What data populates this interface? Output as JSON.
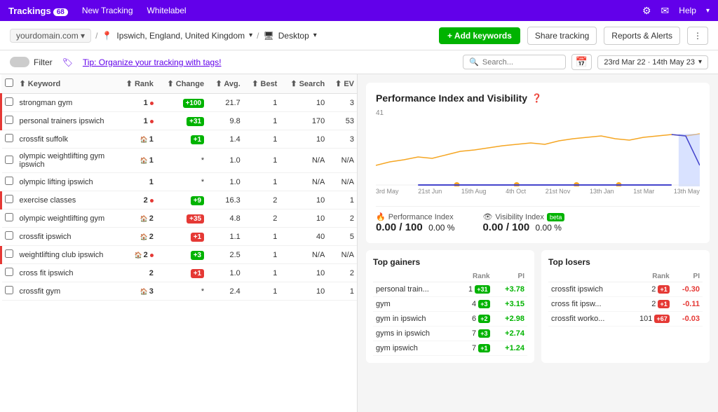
{
  "topNav": {
    "brand": "Trackings",
    "badge": "68",
    "links": [
      "New Tracking",
      "Whitelabel"
    ],
    "helpLabel": "Help"
  },
  "secondaryToolbar": {
    "domainPlaceholder": "yourdomain.com",
    "location": "Ipswich, England, United Kingdom",
    "device": "Desktop",
    "addKeywordsLabel": "+ Add keywords",
    "shareTrackingLabel": "Share tracking",
    "reportsAlertsLabel": "Reports & Alerts"
  },
  "filterBar": {
    "filterLabel": "Filter",
    "tipText": "Tip: Organize your tracking with tags!",
    "searchPlaceholder": "Search...",
    "dateRange": "23rd Mar 22  ·  14th May 23"
  },
  "table": {
    "headers": [
      "",
      "Keyword",
      "Rank",
      "Change",
      "Avg.",
      "Best",
      "Search",
      "EV"
    ],
    "rows": [
      {
        "keyword": "strongman gym",
        "rank": "1",
        "rankDot": "red",
        "change": "+100",
        "changeType": "green",
        "avg": "21.7",
        "best": "1",
        "search": "10",
        "ev": "3"
      },
      {
        "keyword": "personal trainers ipswich",
        "rank": "1",
        "rankDot": "red",
        "change": "+31",
        "changeType": "green",
        "avg": "9.8",
        "best": "1",
        "search": "170",
        "ev": "53"
      },
      {
        "keyword": "crossfit suffolk",
        "rank": "1",
        "rankDot": "",
        "change": "+1",
        "changeType": "green",
        "avg": "1.4",
        "best": "1",
        "search": "10",
        "ev": "3",
        "local": true
      },
      {
        "keyword": "olympic weightlifting gym ipswich",
        "rank": "1",
        "rankDot": "",
        "change": "*",
        "changeType": "none",
        "avg": "1.0",
        "best": "1",
        "search": "N/A",
        "ev": "N/A",
        "local": true
      },
      {
        "keyword": "olympic lifting ipswich",
        "rank": "1",
        "rankDot": "",
        "change": "*",
        "changeType": "none",
        "avg": "1.0",
        "best": "1",
        "search": "N/A",
        "ev": "N/A"
      },
      {
        "keyword": "exercise classes",
        "rank": "2",
        "rankDot": "red",
        "change": "+9",
        "changeType": "green",
        "avg": "16.3",
        "best": "2",
        "search": "10",
        "ev": "1"
      },
      {
        "keyword": "olympic weightlifting gym",
        "rank": "2",
        "rankDot": "",
        "change": "+35",
        "changeType": "red",
        "avg": "4.8",
        "best": "2",
        "search": "10",
        "ev": "2",
        "local": true
      },
      {
        "keyword": "crossfit ipswich",
        "rank": "2",
        "rankDot": "",
        "change": "+1",
        "changeType": "red",
        "avg": "1.1",
        "best": "1",
        "search": "40",
        "ev": "5",
        "local": true
      },
      {
        "keyword": "weightlifting club ipswich",
        "rank": "2",
        "rankDot": "red",
        "change": "+3",
        "changeType": "green",
        "avg": "2.5",
        "best": "1",
        "search": "N/A",
        "ev": "N/A",
        "local": true
      },
      {
        "keyword": "cross fit ipswich",
        "rank": "2",
        "rankDot": "",
        "change": "+1",
        "changeType": "red",
        "avg": "1.0",
        "best": "1",
        "search": "10",
        "ev": "2"
      },
      {
        "keyword": "crossfit gym",
        "rank": "3",
        "rankDot": "",
        "change": "*",
        "changeType": "none",
        "avg": "2.4",
        "best": "1",
        "search": "10",
        "ev": "1",
        "local": true
      }
    ]
  },
  "chart": {
    "title": "Performance Index and Visibility",
    "yLabel": "41",
    "xLabels": [
      "3rd May",
      "21st Jun",
      "15th Aug",
      "4th Oct",
      "21st Nov",
      "13th Jan",
      "1st Mar",
      "13th May"
    ],
    "performanceIndex": {
      "label": "Performance Index",
      "value": "0.00",
      "max": "100",
      "percent": "0.00 %"
    },
    "visibilityIndex": {
      "label": "Visibility Index",
      "value": "0.00",
      "max": "100",
      "percent": "0.00 %",
      "beta": "beta"
    }
  },
  "topGainers": {
    "title": "Top gainers",
    "colRank": "Rank",
    "colPI": "PI",
    "rows": [
      {
        "keyword": "personal train...",
        "rank": "1",
        "badge": "+31",
        "badgeType": "green",
        "pi": "+3.78"
      },
      {
        "keyword": "gym",
        "rank": "4",
        "badge": "+3",
        "badgeType": "green",
        "pi": "+3.15"
      },
      {
        "keyword": "gym in ipswich",
        "rank": "6",
        "badge": "+2",
        "badgeType": "green",
        "pi": "+2.98"
      },
      {
        "keyword": "gyms in ipswich",
        "rank": "7",
        "badge": "+3",
        "badgeType": "green",
        "pi": "+2.74"
      },
      {
        "keyword": "gym ipswich",
        "rank": "7",
        "badge": "+1",
        "badgeType": "green",
        "pi": "+1.24"
      }
    ]
  },
  "topLosers": {
    "title": "Top losers",
    "colRank": "Rank",
    "colPI": "PI",
    "rows": [
      {
        "keyword": "crossfit ipswich",
        "rank": "2",
        "badge": "+1",
        "badgeType": "red",
        "pi": "-0.30"
      },
      {
        "keyword": "cross fit ipsw...",
        "rank": "2",
        "badge": "+1",
        "badgeType": "red",
        "pi": "-0.11"
      },
      {
        "keyword": "crossfit worko...",
        "rank": "101",
        "badge": "+67",
        "badgeType": "red",
        "pi": "-0.03"
      }
    ]
  }
}
